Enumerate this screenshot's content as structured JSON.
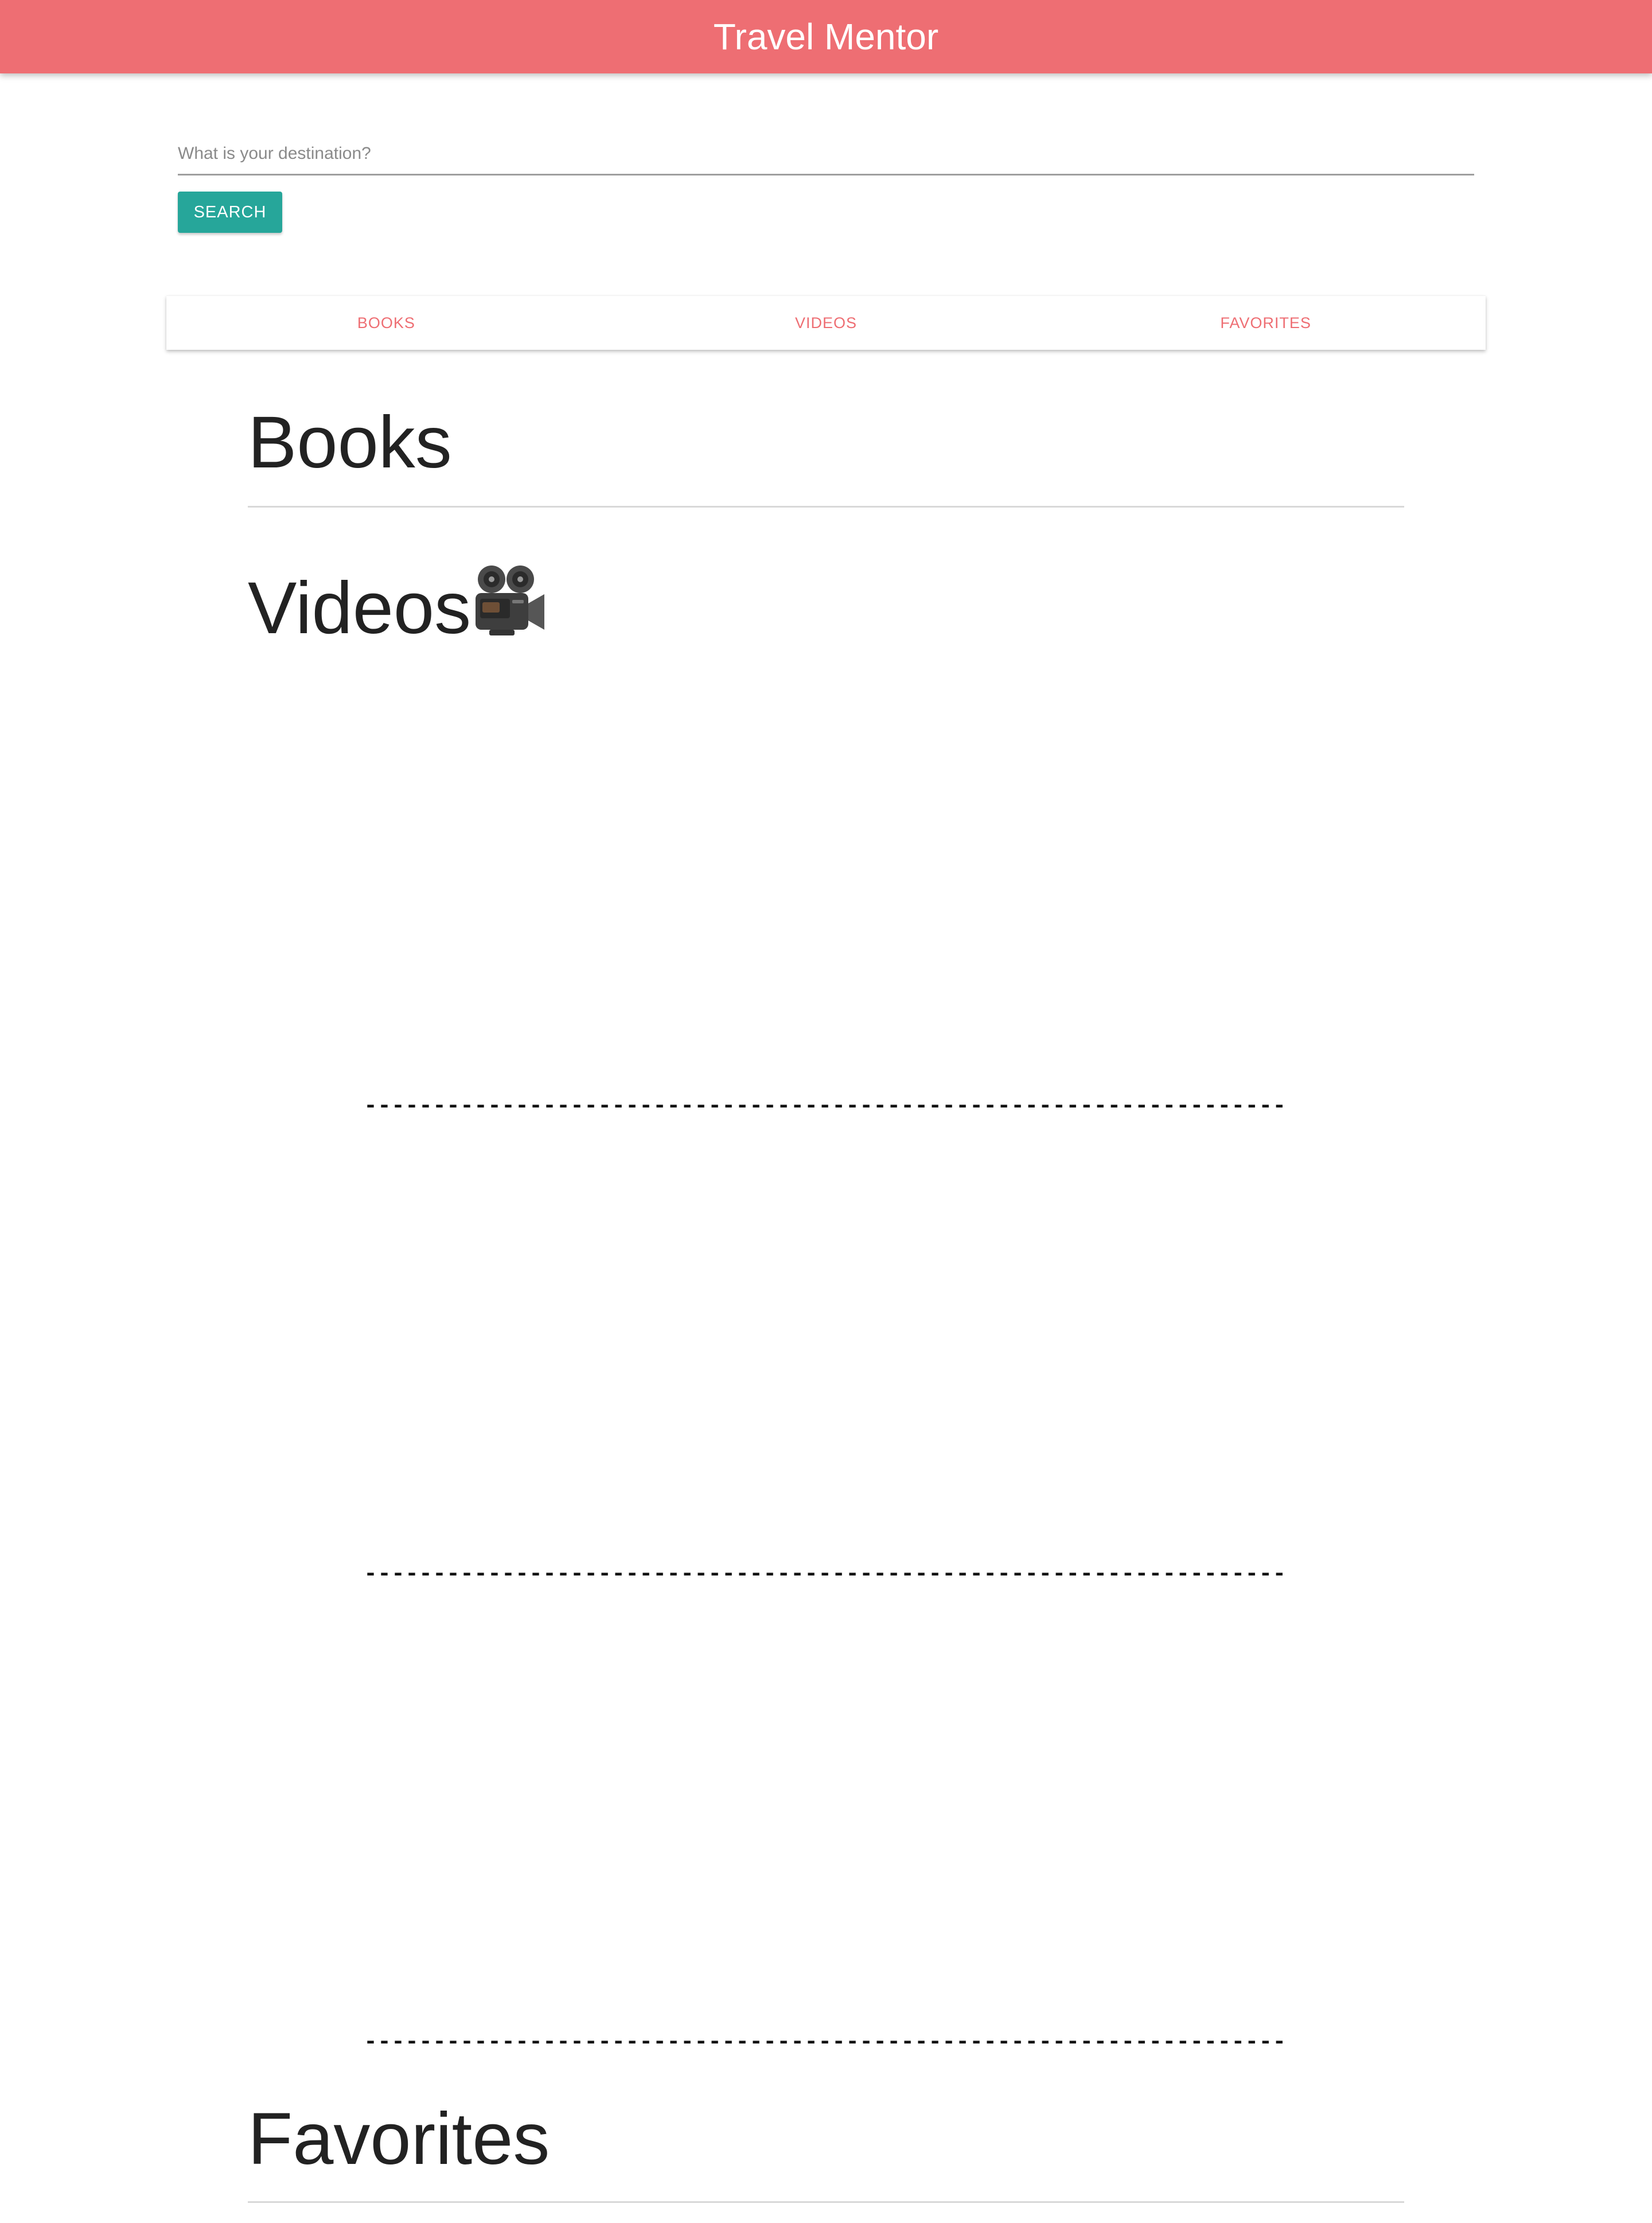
{
  "navbar": {
    "brand": "Travel Mentor",
    "color": "#ee6e73"
  },
  "search": {
    "placeholder": "What is your destination?",
    "value": "",
    "button_label": "SEARCH",
    "button_color": "#26a69a"
  },
  "tabs": [
    {
      "label": "BOOKS"
    },
    {
      "label": "VIDEOS"
    },
    {
      "label": "FAVORITES"
    }
  ],
  "sections": {
    "books": {
      "title": "Books"
    },
    "videos": {
      "title": "Videos",
      "icon": "movie-camera-icon"
    },
    "favorites": {
      "title": "Favorites"
    }
  },
  "video_separators": [
    "--------------------------------------------------------------------------------------------",
    "--------------------------------------------------------------------------------------------",
    "--------------------------------------------------------------------------------------------"
  ]
}
